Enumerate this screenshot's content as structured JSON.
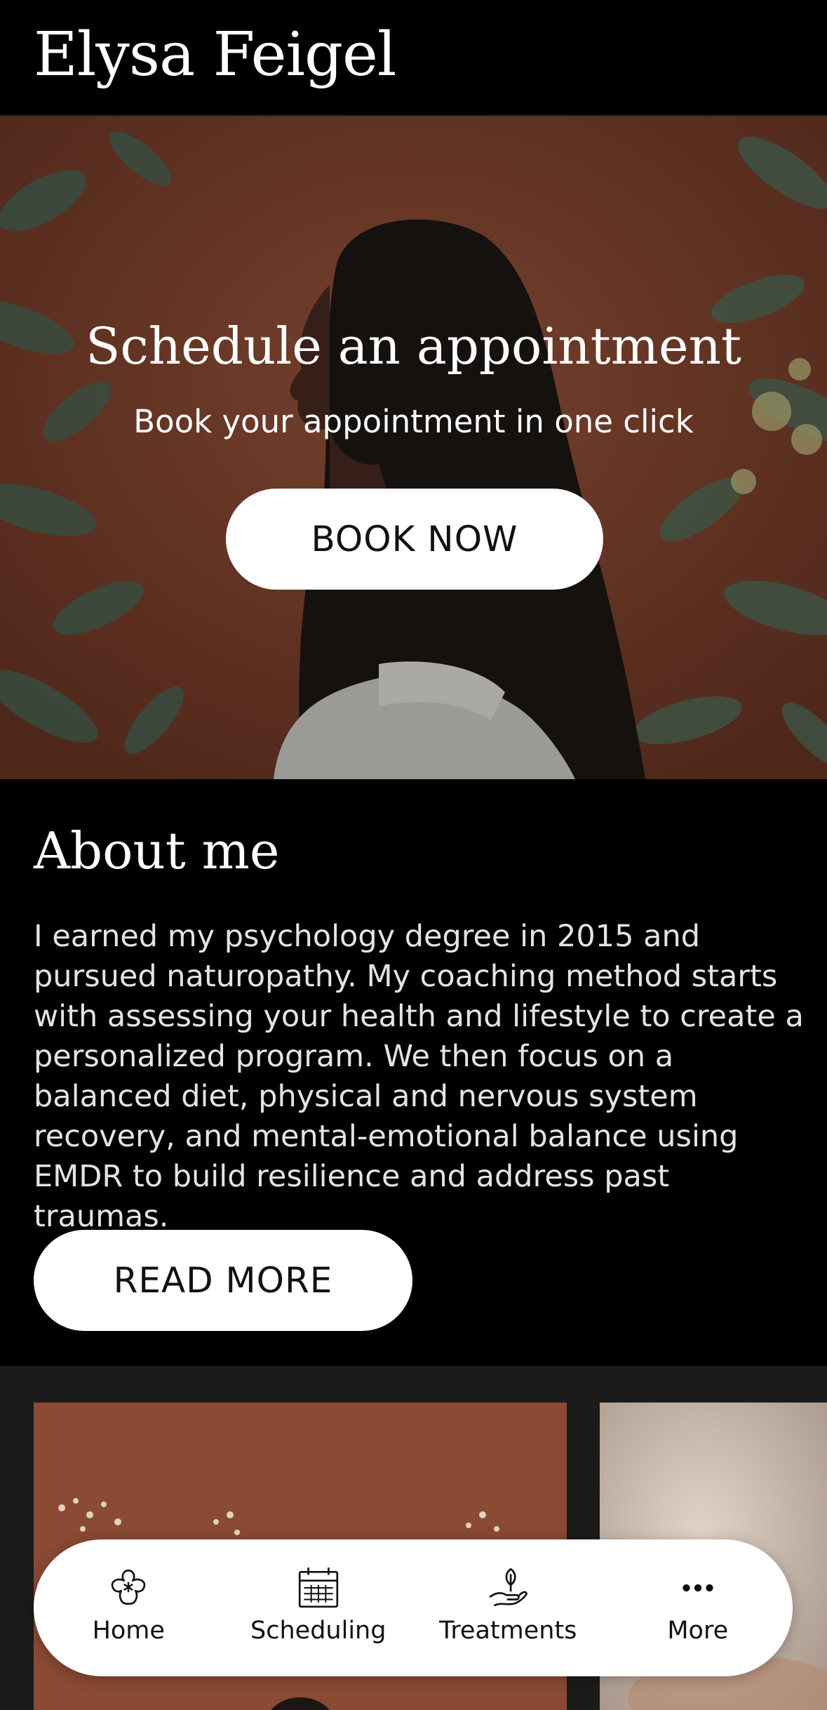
{
  "header": {
    "site_title": "Elysa Feigel"
  },
  "hero": {
    "title": "Schedule an appointment",
    "subtitle": "Book your appointment in one click",
    "button_label": "BOOK NOW"
  },
  "about": {
    "title": "About me",
    "body": "I earned my psychology degree in 2015 and pursued naturopathy. My coaching method starts with assessing your health and lifestyle to create a personalized program. We then focus on a balanced diet, physical and nervous system recovery, and mental-emotional balance using EMDR to build resilience and address past traumas.",
    "button_label": "READ MORE"
  },
  "tabbar": {
    "items": [
      {
        "label": "Home",
        "icon": "flower-icon"
      },
      {
        "label": "Scheduling",
        "icon": "calendar-icon"
      },
      {
        "label": "Treatments",
        "icon": "hand-plant-icon"
      },
      {
        "label": "More",
        "icon": "more-dots-icon"
      }
    ]
  },
  "colors": {
    "background": "#000000",
    "hero_wall": "#8a4a34",
    "button_bg": "#ffffff",
    "gallery_bg": "#1b1b1b"
  }
}
